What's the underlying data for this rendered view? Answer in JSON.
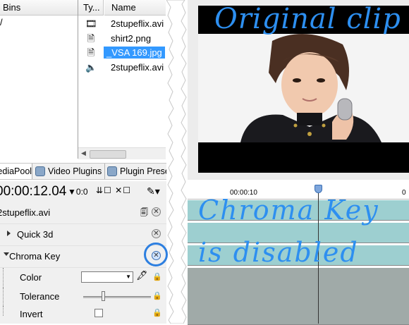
{
  "bins": {
    "header": "Bins",
    "tree_item": "/"
  },
  "files": {
    "col_type": "Ty...",
    "col_name": "Name",
    "rows": [
      {
        "icon": "video-file-icon",
        "name": "2stupeflix.avi"
      },
      {
        "icon": "image-file-icon",
        "name": "shirt2.png"
      },
      {
        "icon": "image-file-icon",
        "name": "_VSA 169.jpg",
        "selected": true
      },
      {
        "icon": "audio-file-icon",
        "name": "2stupeflix.avi"
      }
    ]
  },
  "tabs": [
    {
      "label": "MediaPool"
    },
    {
      "label": "Video Plugins"
    },
    {
      "label": "Plugin Presets"
    }
  ],
  "transport": {
    "timecode": "00:00:12.04",
    "speed": "0:0"
  },
  "plugins": {
    "clip_name": "2stupeflix.avi",
    "items": [
      {
        "label": "Quick 3d",
        "expanded": false
      },
      {
        "label": "Chroma Key",
        "expanded": true,
        "enabled": false
      }
    ],
    "chroma_params": {
      "color_label": "Color",
      "tolerance_label": "Tolerance",
      "tolerance_level": 0.3,
      "invert_label": "Invert",
      "invert_checked": false
    }
  },
  "preview": {
    "annotation": "Original clip"
  },
  "timeline": {
    "ruler_label": "00:00:10",
    "ruler_label_2": "0",
    "annotation_line1": "Chroma Key",
    "annotation_line2": "is disabled"
  },
  "colors": {
    "annotation_blue": "#2d8ff0",
    "track_teal": "#9dcfd0",
    "track_grey": "#a0aaa8",
    "selection": "#3399ff"
  }
}
